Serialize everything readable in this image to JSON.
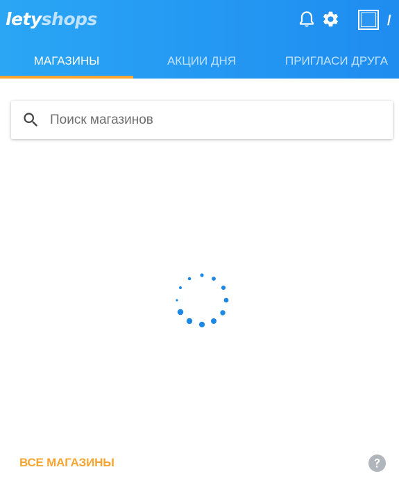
{
  "header": {
    "logo_part1": "lety",
    "logo_part2": "shops",
    "icons": [
      "bell-icon",
      "gear-icon",
      "avatar-icon"
    ],
    "user_suffix": "/"
  },
  "tabs": [
    {
      "label": "Магазины",
      "active": true
    },
    {
      "label": "Акции дня",
      "active": false
    },
    {
      "label": "Пригласи друга",
      "active": false
    }
  ],
  "search": {
    "placeholder": "Поиск магазинов",
    "value": ""
  },
  "loading": true,
  "footer": {
    "all_shops_label": "Все магазины",
    "help_icon": "help-icon"
  },
  "colors": {
    "header_bg": "#1f8cf0",
    "accent": "#f7a532",
    "spinner": "#1e88e5",
    "help": "#b0b6bb"
  }
}
